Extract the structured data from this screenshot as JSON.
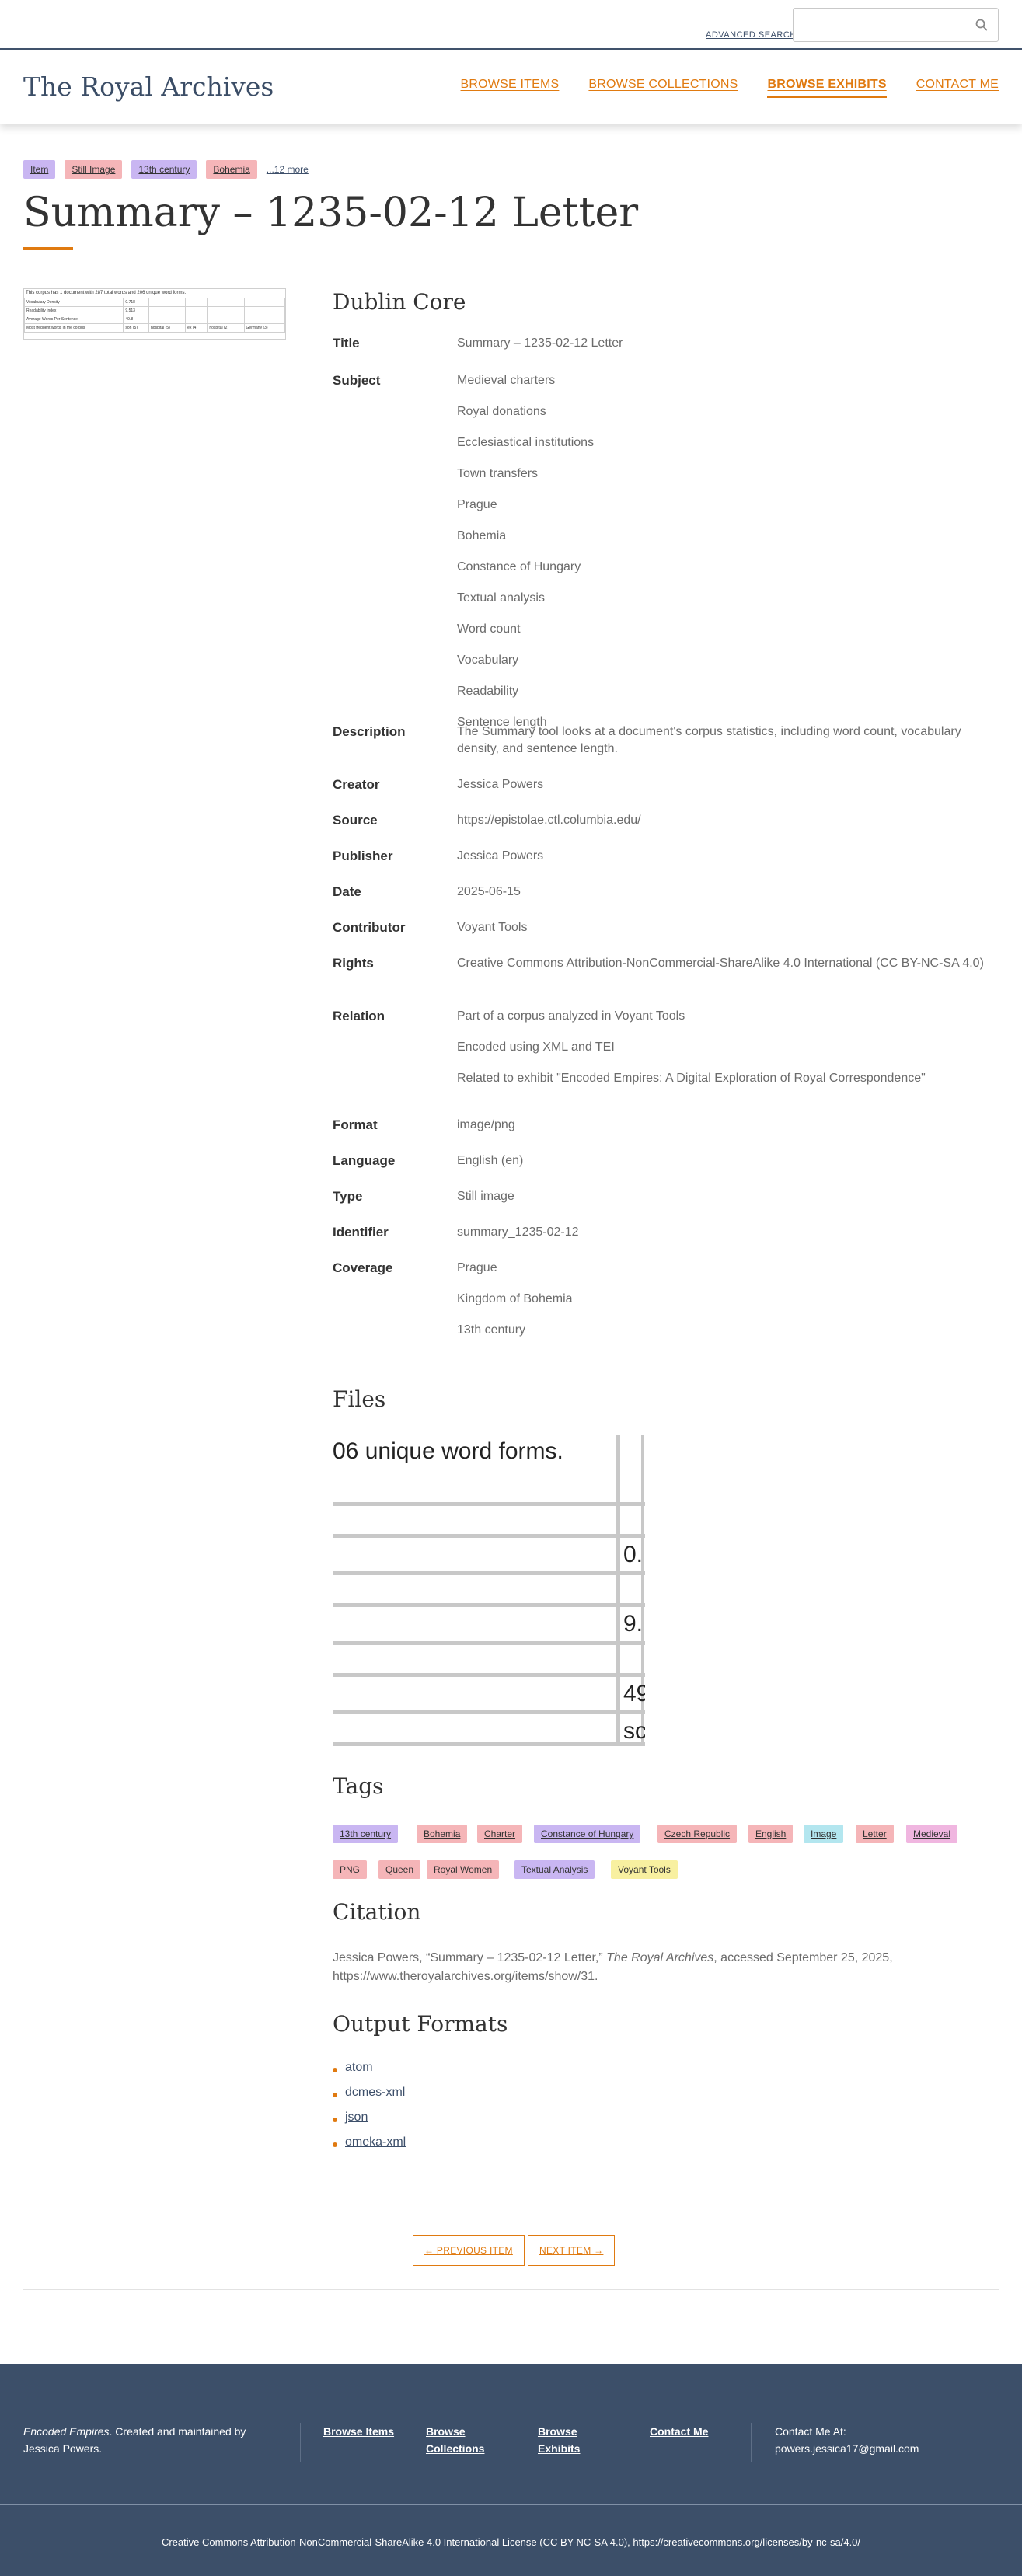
{
  "topbar": {
    "advanced_search": "ADVANCED SEARCH",
    "search_placeholder": ""
  },
  "header": {
    "site_title": "The Royal Archives",
    "nav": [
      "BROWSE ITEMS",
      "BROWSE COLLECTIONS",
      "BROWSE EXHIBITS",
      "CONTACT ME"
    ],
    "active_nav": "BROWSE EXHIBITS"
  },
  "item": {
    "top_tags": [
      {
        "label": "Item",
        "color": "#c9b6f2"
      },
      {
        "label": "Still Image",
        "color": "#f5b5b8"
      },
      {
        "label": "13th century",
        "color": "#c9b6f2"
      },
      {
        "label": "Bohemia",
        "color": "#f5b5b8"
      }
    ],
    "more_tags": "...12 more",
    "title": "Summary – 1235-02-12 Letter"
  },
  "thumbnail": {
    "caption": "This corpus has 1 document with 287 total words and 206 unique word forms.",
    "rows": [
      [
        "Vocabulary Density",
        "0.718",
        "",
        "",
        "",
        ""
      ],
      [
        "Readability Index",
        "9.513",
        "",
        "",
        "",
        ""
      ],
      [
        "Average Words Per Sentence",
        "49.8",
        "",
        "",
        "",
        ""
      ],
      [
        "Most frequent words in the corpus",
        "son (5)",
        "hospital (5)",
        "ex (4)",
        "hospital (2)",
        "Germany (3)"
      ]
    ]
  },
  "dublin_core": {
    "heading": "Dublin Core",
    "fields": [
      {
        "label": "Title",
        "values": [
          "Summary – 1235-02-12 Letter"
        ]
      },
      {
        "label": "Subject",
        "values": [
          "Medieval charters",
          "Royal donations",
          "Ecclesiastical institutions",
          "Town transfers",
          "Prague",
          "Bohemia",
          "Constance of Hungary",
          "Textual analysis",
          "Word count",
          "Vocabulary",
          "Readability",
          "Sentence length"
        ]
      },
      {
        "label": "Description",
        "values": [
          "The Summary tool looks at a document's corpus statistics, including word count, vocabulary density, and sentence length."
        ]
      },
      {
        "label": "Creator",
        "values": [
          "Jessica Powers"
        ]
      },
      {
        "label": "Source",
        "values": [
          "https://epistolae.ctl.columbia.edu/"
        ]
      },
      {
        "label": "Publisher",
        "values": [
          "Jessica Powers"
        ]
      },
      {
        "label": "Date",
        "values": [
          "2025-06-15"
        ]
      },
      {
        "label": "Contributor",
        "values": [
          "Voyant Tools"
        ]
      },
      {
        "label": "Rights",
        "values": [
          "Creative Commons Attribution-NonCommercial-ShareAlike 4.0 International (CC BY-NC-SA 4.0)"
        ]
      },
      {
        "label": "Relation",
        "values": [
          "Part of a corpus analyzed in Voyant Tools",
          "Encoded using XML and TEI",
          "Related to exhibit \"Encoded Empires: A Digital Exploration of Royal Correspondence\""
        ]
      },
      {
        "label": "Format",
        "values": [
          "image/png"
        ]
      },
      {
        "label": "Language",
        "values": [
          "English (en)"
        ]
      },
      {
        "label": "Type",
        "values": [
          "Still image"
        ]
      },
      {
        "label": "Identifier",
        "values": [
          "summary_1235-02-12"
        ]
      },
      {
        "label": "Coverage",
        "values": [
          "Prague",
          "Kingdom of Bohemia",
          "13th century"
        ]
      }
    ]
  },
  "files": {
    "heading": "Files",
    "image_text": [
      "06 unique word forms.",
      "0.",
      "9.",
      "49",
      "sc"
    ]
  },
  "tags": {
    "heading": "Tags",
    "items": [
      {
        "label": "13th century",
        "color": "#c9b6f2"
      },
      {
        "label": "Bohemia",
        "color": "#f5b5b8"
      },
      {
        "label": "Charter",
        "color": "#f5b5b8"
      },
      {
        "label": "Constance of Hungary",
        "color": "#c9b6f2"
      },
      {
        "label": "Czech Republic",
        "color": "#f5b5b8"
      },
      {
        "label": "English",
        "color": "#f5b5b8"
      },
      {
        "label": "Image",
        "color": "#b3e6ef"
      },
      {
        "label": "Letter",
        "color": "#f5b5b8"
      },
      {
        "label": "Medieval",
        "color": "#f0b6e0"
      },
      {
        "label": "PNG",
        "color": "#f5b5b8"
      },
      {
        "label": "Queen",
        "color": "#f5b5b8"
      },
      {
        "label": "Royal Women",
        "color": "#f5b5b8"
      },
      {
        "label": "Textual Analysis",
        "color": "#c9b6f2"
      },
      {
        "label": "Voyant Tools",
        "color": "#f8f0a0"
      }
    ]
  },
  "citation": {
    "heading": "Citation",
    "author": "Jessica Powers, “Summary – 1235-02-12 Letter,”",
    "source": "The Royal Archives",
    "rest": ", accessed September 25, 2025, https://www.theroyalarchives.org/items/show/31."
  },
  "output_formats": {
    "heading": "Output Formats",
    "items": [
      "atom",
      "dcmes-xml",
      "json",
      "omeka-xml"
    ]
  },
  "pagination": {
    "previous": "← PREVIOUS ITEM",
    "next": "NEXT ITEM →"
  },
  "footer": {
    "about_italic": "Encoded Empires",
    "about_rest": ". Created and maintained by Jessica Powers.",
    "links": [
      "Browse Items",
      "Browse Collections",
      "Browse Exhibits",
      "Contact Me"
    ],
    "contact_label": "Contact Me At:",
    "contact_email": "powers.jessica17@gmail.com",
    "license": "Creative Commons Attribution-NonCommercial-ShareAlike 4.0 International License (CC BY-NC-SA 4.0), https://creativecommons.org/licenses/by-nc-sa/4.0/"
  },
  "colors": {
    "accent": "#e07a10",
    "brand": "#3c4f69"
  }
}
